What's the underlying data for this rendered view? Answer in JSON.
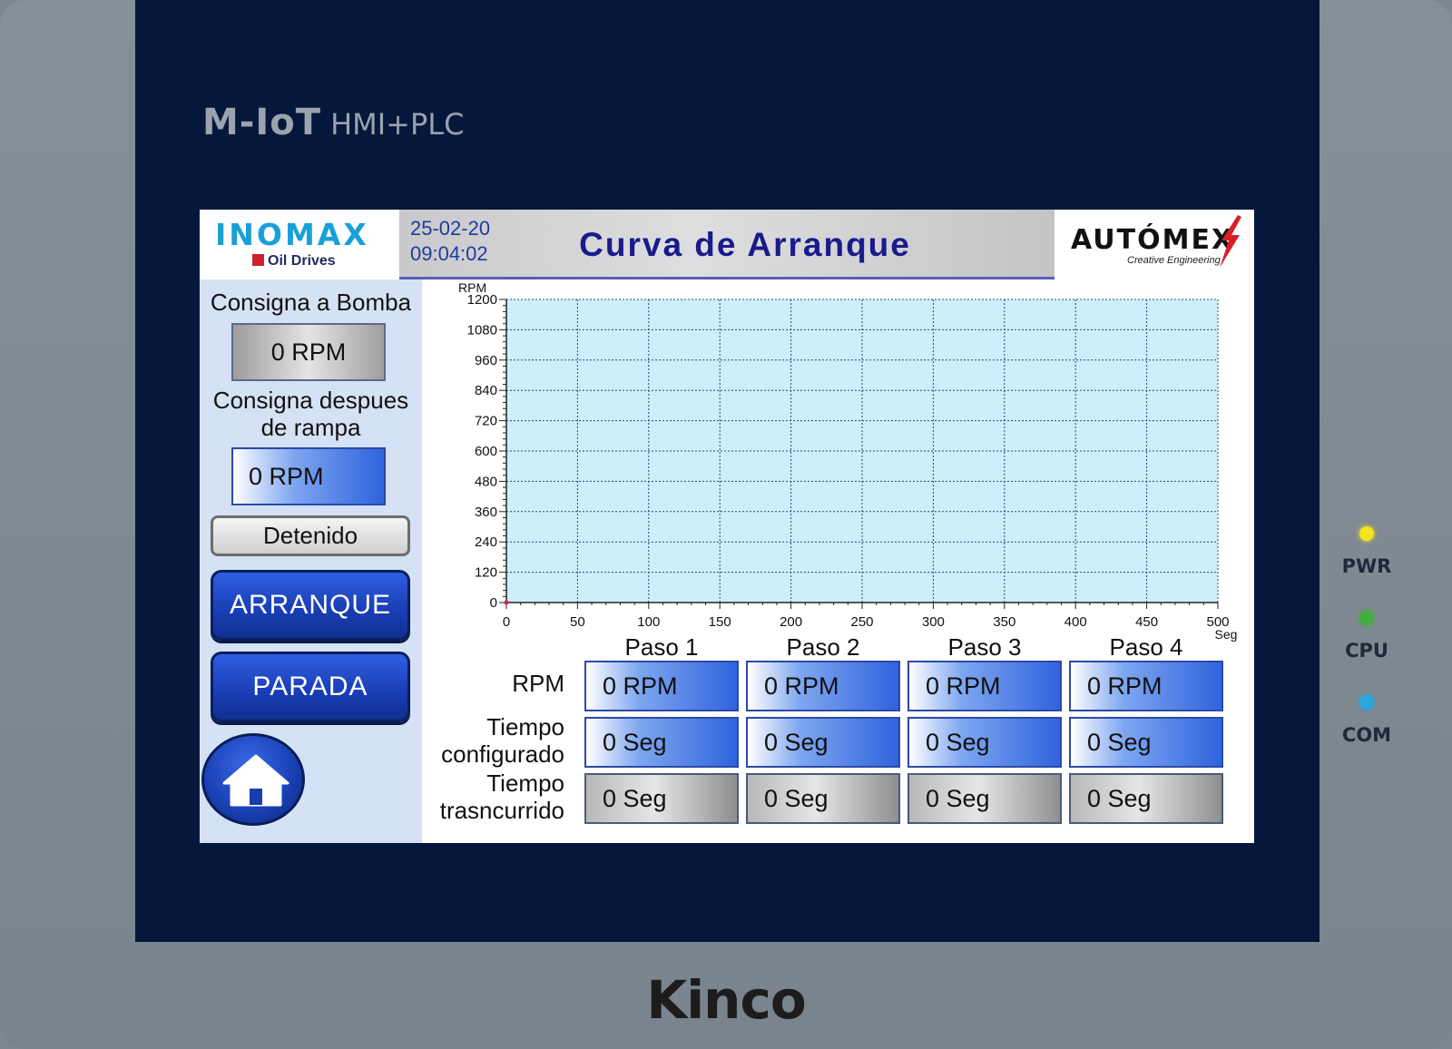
{
  "device": {
    "brand_top_big": "M-IoT",
    "brand_top_small": "HMI+PLC",
    "brand_bottom": "Kinco",
    "leds": [
      {
        "label": "PWR",
        "color": "#f2e51e"
      },
      {
        "label": "CPU",
        "color": "#3fae3f"
      },
      {
        "label": "COM",
        "color": "#2aa7e0"
      }
    ]
  },
  "header": {
    "left_logo": "INOMAX",
    "left_logo_sub": "Oil Drives",
    "date": "25-02-20",
    "time": "09:04:02",
    "title": "Curva de Arranque",
    "right_logo": "AUTÓMEX",
    "right_logo_sub": "Creative Engineering"
  },
  "left_panel": {
    "consigna_bomba_label": "Consigna a Bomba",
    "consigna_bomba_value": "0 RPM",
    "consigna_rampa_label_1": "Consigna despues",
    "consigna_rampa_label_2": "de rampa",
    "consigna_rampa_value": "0 RPM",
    "status": "Detenido",
    "start_button": "ARRANQUE",
    "stop_button": "PARADA"
  },
  "chart_data": {
    "type": "line",
    "ylabel": "RPM",
    "xlabel": "Seg",
    "xlim": [
      0,
      500
    ],
    "ylim": [
      0,
      1200
    ],
    "x_ticks": [
      "0",
      "50",
      "100",
      "150",
      "200",
      "250",
      "300",
      "350",
      "400",
      "450",
      "500"
    ],
    "y_ticks": [
      "0",
      "120",
      "240",
      "360",
      "480",
      "600",
      "720",
      "840",
      "960",
      "1080",
      "1200"
    ],
    "grid": true,
    "background": "#cdeefb",
    "series": [
      {
        "x": [
          0
        ],
        "y": [
          0
        ],
        "color": "#d02060"
      }
    ]
  },
  "steps": {
    "headers": [
      "Paso 1",
      "Paso 2",
      "Paso 3",
      "Paso 4"
    ],
    "row_rpm_label": "RPM",
    "row_config_label_1": "Tiempo",
    "row_config_label_2": "configurado",
    "row_elapsed_label_1": "Tiempo",
    "row_elapsed_label_2": "trasncurrido",
    "rpm": [
      "0 RPM",
      "0 RPM",
      "0 RPM",
      "0 RPM"
    ],
    "configured": [
      "0 Seg",
      "0 Seg",
      "0 Seg",
      "0 Seg"
    ],
    "elapsed": [
      "0 Seg",
      "0 Seg",
      "0 Seg",
      "0 Seg"
    ]
  }
}
